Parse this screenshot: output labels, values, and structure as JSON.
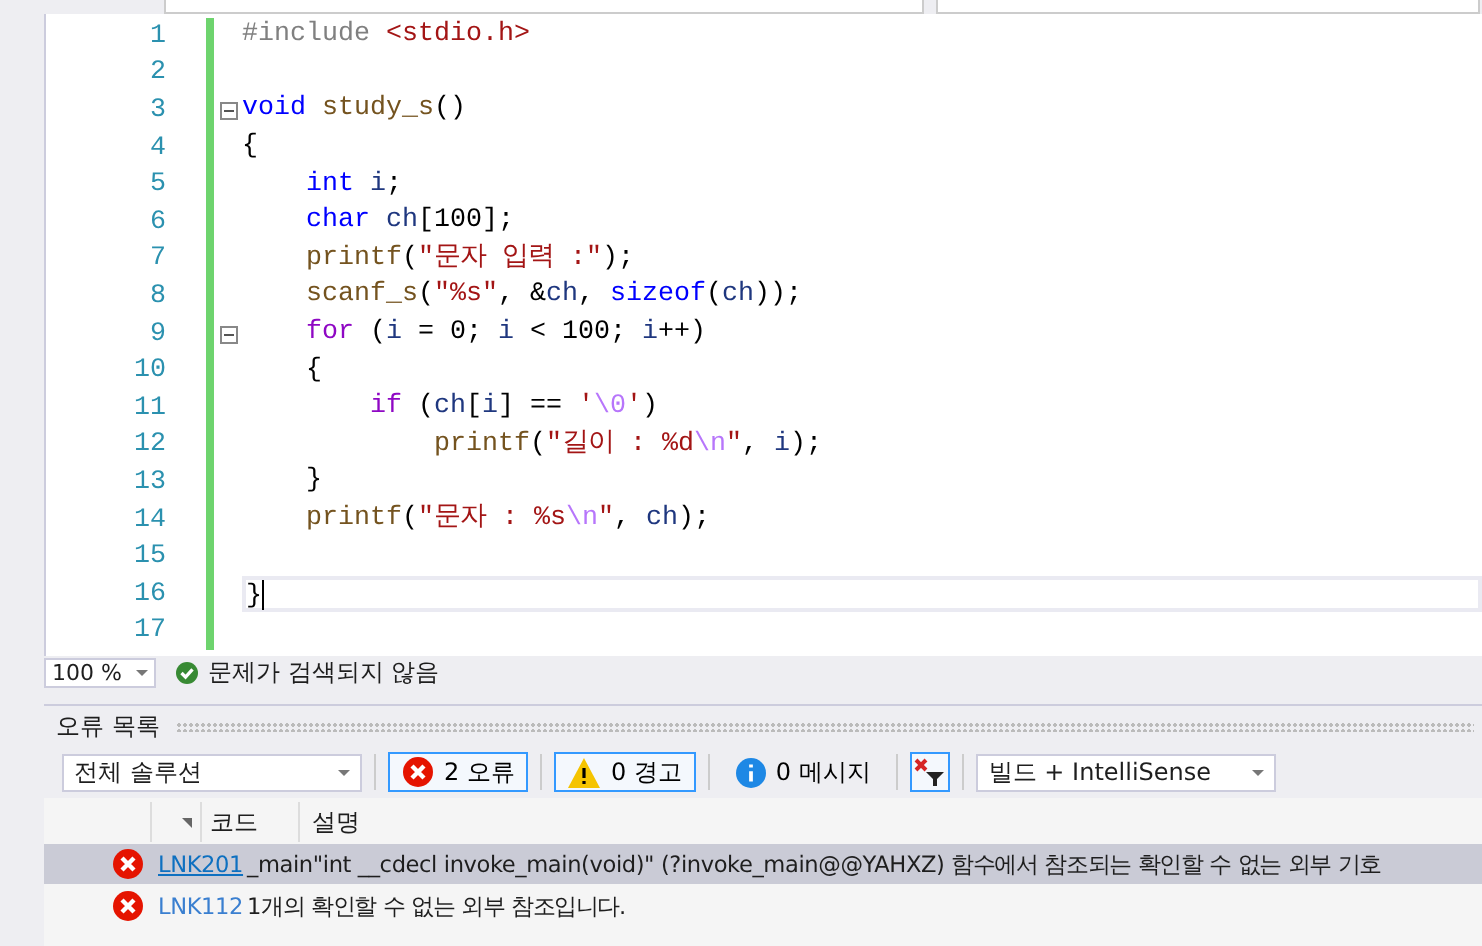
{
  "editor": {
    "lines": [
      {
        "number": "1",
        "tokens": [
          {
            "text": "#include ",
            "kind": "pre"
          },
          {
            "text": "<stdio.h>",
            "kind": "str"
          }
        ]
      },
      {
        "number": "2"
      },
      {
        "number": "3",
        "fold": true,
        "tokens": [
          {
            "text": "void",
            "kind": "kw"
          },
          {
            "text": " study_s",
            "kind": "fn"
          },
          {
            "text": "()",
            "kind": "plain"
          }
        ]
      },
      {
        "number": "4",
        "tokens": [
          {
            "text": "{",
            "kind": "plain"
          }
        ]
      },
      {
        "number": "5",
        "tokens": [
          {
            "text": "    int",
            "kind": "kw"
          },
          {
            "text": " i",
            "kind": "var"
          },
          {
            "text": ";",
            "kind": "plain"
          }
        ]
      },
      {
        "number": "6",
        "tokens": [
          {
            "text": "    char",
            "kind": "kw"
          },
          {
            "text": " ch",
            "kind": "var"
          },
          {
            "text": "[100];",
            "kind": "plain"
          }
        ]
      },
      {
        "number": "7",
        "tokens": [
          {
            "text": "    printf",
            "kind": "fn"
          },
          {
            "text": "(",
            "kind": "plain"
          },
          {
            "text": "\"문자 입력 :\"",
            "kind": "str"
          },
          {
            "text": ");",
            "kind": "plain"
          }
        ]
      },
      {
        "number": "8",
        "tokens": [
          {
            "text": "    scanf_s",
            "kind": "fn"
          },
          {
            "text": "(",
            "kind": "plain"
          },
          {
            "text": "\"%s\"",
            "kind": "str"
          },
          {
            "text": ", &",
            "kind": "plain"
          },
          {
            "text": "ch",
            "kind": "var"
          },
          {
            "text": ", ",
            "kind": "plain"
          },
          {
            "text": "sizeof",
            "kind": "kw"
          },
          {
            "text": "(",
            "kind": "plain"
          },
          {
            "text": "ch",
            "kind": "var"
          },
          {
            "text": "));",
            "kind": "plain"
          }
        ]
      },
      {
        "number": "9",
        "fold": true,
        "tokens": [
          {
            "text": "    for",
            "kind": "ctl"
          },
          {
            "text": " (",
            "kind": "plain"
          },
          {
            "text": "i",
            "kind": "var"
          },
          {
            "text": " = 0; ",
            "kind": "plain"
          },
          {
            "text": "i",
            "kind": "var"
          },
          {
            "text": " < 100; ",
            "kind": "plain"
          },
          {
            "text": "i",
            "kind": "var"
          },
          {
            "text": "++)",
            "kind": "plain"
          }
        ]
      },
      {
        "number": "10",
        "tokens": [
          {
            "text": "    {",
            "kind": "plain"
          }
        ]
      },
      {
        "number": "11",
        "tokens": [
          {
            "text": "        if",
            "kind": "ctl"
          },
          {
            "text": " (",
            "kind": "plain"
          },
          {
            "text": "ch",
            "kind": "var"
          },
          {
            "text": "[",
            "kind": "plain"
          },
          {
            "text": "i",
            "kind": "var"
          },
          {
            "text": "] == ",
            "kind": "plain"
          },
          {
            "text": "'",
            "kind": "str"
          },
          {
            "text": "\\0",
            "kind": "esc"
          },
          {
            "text": "'",
            "kind": "str"
          },
          {
            "text": ")",
            "kind": "plain"
          }
        ]
      },
      {
        "number": "12",
        "tokens": [
          {
            "text": "            printf",
            "kind": "fn"
          },
          {
            "text": "(",
            "kind": "plain"
          },
          {
            "text": "\"길이 : %d",
            "kind": "str"
          },
          {
            "text": "\\n",
            "kind": "esc"
          },
          {
            "text": "\"",
            "kind": "str"
          },
          {
            "text": ", ",
            "kind": "plain"
          },
          {
            "text": "i",
            "kind": "var"
          },
          {
            "text": ");",
            "kind": "plain"
          }
        ]
      },
      {
        "number": "13",
        "tokens": [
          {
            "text": "    }",
            "kind": "plain"
          }
        ]
      },
      {
        "number": "14",
        "tokens": [
          {
            "text": "    printf",
            "kind": "fn"
          },
          {
            "text": "(",
            "kind": "plain"
          },
          {
            "text": "\"문자 : %s",
            "kind": "str"
          },
          {
            "text": "\\n",
            "kind": "esc"
          },
          {
            "text": "\"",
            "kind": "str"
          },
          {
            "text": ", ",
            "kind": "plain"
          },
          {
            "text": "ch",
            "kind": "var"
          },
          {
            "text": ");",
            "kind": "plain"
          }
        ]
      },
      {
        "number": "15"
      },
      {
        "number": "16",
        "current": true,
        "tokens": [
          {
            "text": "}",
            "kind": "plain"
          }
        ]
      },
      {
        "number": "17"
      }
    ]
  },
  "status_bar": {
    "zoom": "100 %",
    "message": "문제가 검색되지 않음"
  },
  "error_list": {
    "title": "오류 목록",
    "scope": "전체 솔루션",
    "filters": [
      {
        "kind": "error",
        "label": "2 오류",
        "selected": true
      },
      {
        "kind": "warning",
        "label": "0 경고",
        "selected": true
      },
      {
        "kind": "info",
        "label": "0 메시지",
        "selected": false
      }
    ],
    "source": "빌드 + IntelliSense",
    "columns": [
      "코드",
      "설명"
    ],
    "rows": [
      {
        "code": "LNK201",
        "description": "_main\"int __cdecl invoke_main(void)\" (?invoke_main@@YAHXZ) 함수에서 참조되는 확인할 수 없는 외부 기호",
        "selected": true
      },
      {
        "code": "LNK112",
        "description": "1개의 확인할 수 없는 외부 참조입니다.",
        "selected": false
      }
    ]
  }
}
